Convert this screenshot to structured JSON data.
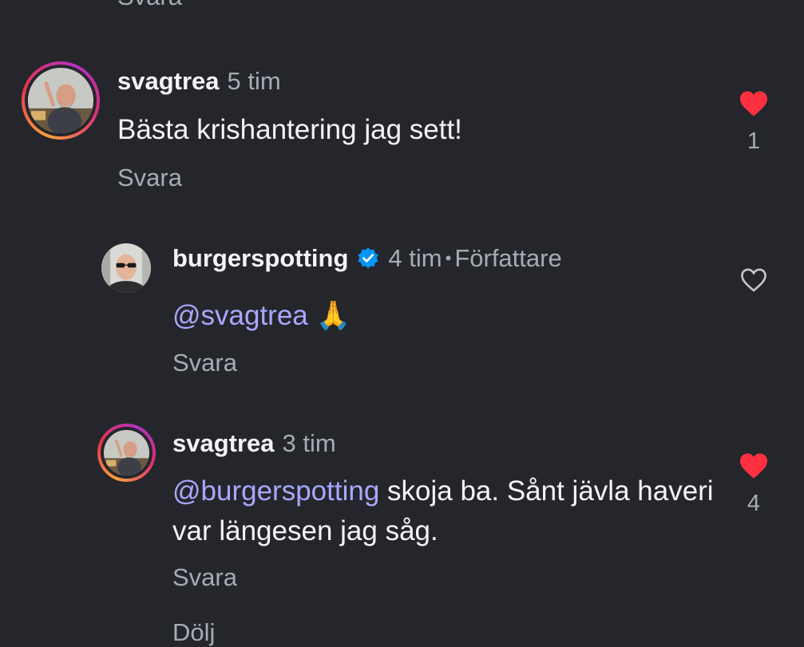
{
  "top_cut_reply": "Svara",
  "bottom_cut_text": "Dölj",
  "comments": [
    {
      "username": "svagtrea",
      "time": "5 tim",
      "text": "Bästa krishantering jag sett!",
      "reply_label": "Svara",
      "liked": true,
      "like_count": "1",
      "avatar_icon": "bearded-man-avatar"
    },
    {
      "username": "burgerspotting",
      "verified": true,
      "time": "4 tim",
      "separator": "•",
      "author_label": "Författare",
      "mention": "@svagtrea",
      "text": " 🙏",
      "reply_label": "Svara",
      "liked": false,
      "avatar_icon": "sunglasses-man-avatar"
    },
    {
      "username": "svagtrea",
      "time": "3 tim",
      "mention": "@burgerspotting",
      "text": " skoja ba. Sånt jävla haveri var längesen jag såg.",
      "reply_label": "Svara",
      "liked": true,
      "like_count": "4",
      "avatar_icon": "bearded-man-avatar"
    }
  ],
  "colors": {
    "background": "#25262b",
    "mention": "#a7a8ff",
    "heart_liked": "#ff3040",
    "verified": "#0095f6",
    "muted_text": "#a7abb3"
  }
}
